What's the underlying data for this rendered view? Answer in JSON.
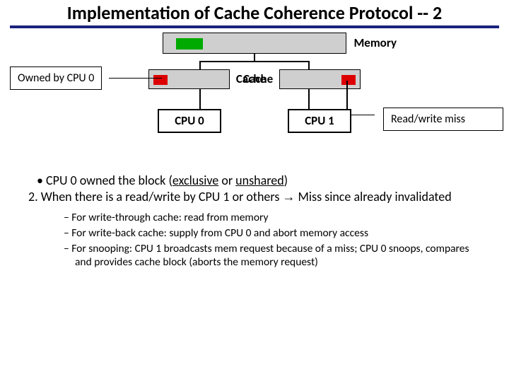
{
  "title": "Implementation of Cache Coherence Protocol -- 2",
  "diagram": {
    "memory_label": "Memory",
    "cache_label": "Cache",
    "cpu0_label": "CPU 0",
    "cpu1_label": "CPU 1",
    "owned_label": "Owned by CPU 0",
    "rw_label": "Read/write miss"
  },
  "bullets": {
    "b1_a": "CPU 0 owned the block (",
    "b1_excl": "exclusive",
    "b1_or": " or ",
    "b1_unsh": "unshared",
    "b1_b": ")",
    "l2": "2. When there is a read/write by CPU 1 or others ",
    "arrow": "→",
    "l2b": " Miss since already invalidated"
  },
  "sub": {
    "s1": "For write-through cache: read from memory",
    "s2": "For write-back cache: supply from CPU 0 and abort memory access",
    "s3": "For snooping: CPU 1 broadcasts mem request because of a miss; CPU 0 snoops, compares and provides cache block (aborts the memory request)"
  }
}
